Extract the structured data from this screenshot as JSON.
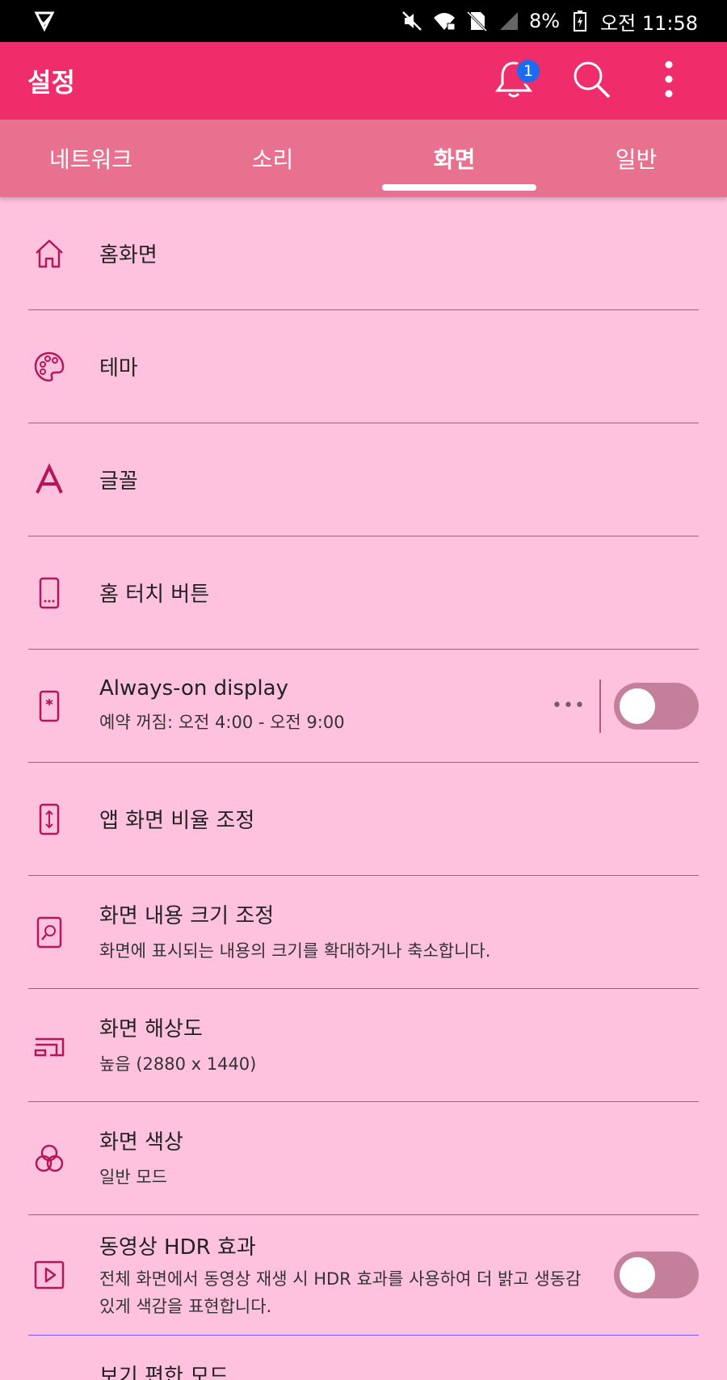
{
  "status_bar": {
    "battery": "8%",
    "time": "오전 11:58",
    "icons": [
      "play-shield-icon",
      "mute-icon",
      "wifi-lock-icon",
      "no-sim-icon",
      "signal-icon",
      "battery-charging-icon"
    ]
  },
  "app_bar": {
    "title": "설정",
    "notification_count": "1",
    "actions": [
      "bell-icon",
      "search-icon",
      "more-vertical-icon"
    ]
  },
  "tabs": [
    {
      "label": "네트워크",
      "active": false
    },
    {
      "label": "소리",
      "active": false
    },
    {
      "label": "화면",
      "active": true
    },
    {
      "label": "일반",
      "active": false
    }
  ],
  "items": [
    {
      "icon": "home-icon",
      "title": "홈화면"
    },
    {
      "icon": "palette-icon",
      "title": "테마"
    },
    {
      "icon": "font-icon",
      "title": "글꼴"
    },
    {
      "icon": "home-touch-button-icon",
      "title": "홈 터치 버튼"
    },
    {
      "icon": "always-on-display-icon",
      "title": "Always-on display",
      "subtitle": "예약 꺼짐: 오전 4:00 - 오전 9:00",
      "toggle": false
    },
    {
      "icon": "aspect-ratio-icon",
      "title": "앱 화면 비율 조정"
    },
    {
      "icon": "zoom-content-icon",
      "title": "화면 내용 크기 조정",
      "subtitle": "화면에 표시되는 내용의 크기를 확대하거나 축소합니다."
    },
    {
      "icon": "resolution-icon",
      "title": "화면 해상도",
      "subtitle": "높음 (2880 x 1440)"
    },
    {
      "icon": "color-icon",
      "title": "화면 색상",
      "subtitle": "일반 모드"
    },
    {
      "icon": "video-hdr-icon",
      "title": "동영상 HDR 효과",
      "subtitle": "전체 화면에서 동영상 재생 시 HDR 효과를 사용하여 더 밝고 생동감 있게 색감을 표현합니다.",
      "toggle": false
    },
    {
      "title": "보기 편한 모드"
    }
  ],
  "colors": {
    "app_bar": "#ef2d6a",
    "tabs": "#e8718f",
    "background": "#ffc2de",
    "divider": "#7d5df0",
    "icon": "#b5165a",
    "toggle_track": "#c4809b",
    "badge": "#1a6cf0"
  }
}
